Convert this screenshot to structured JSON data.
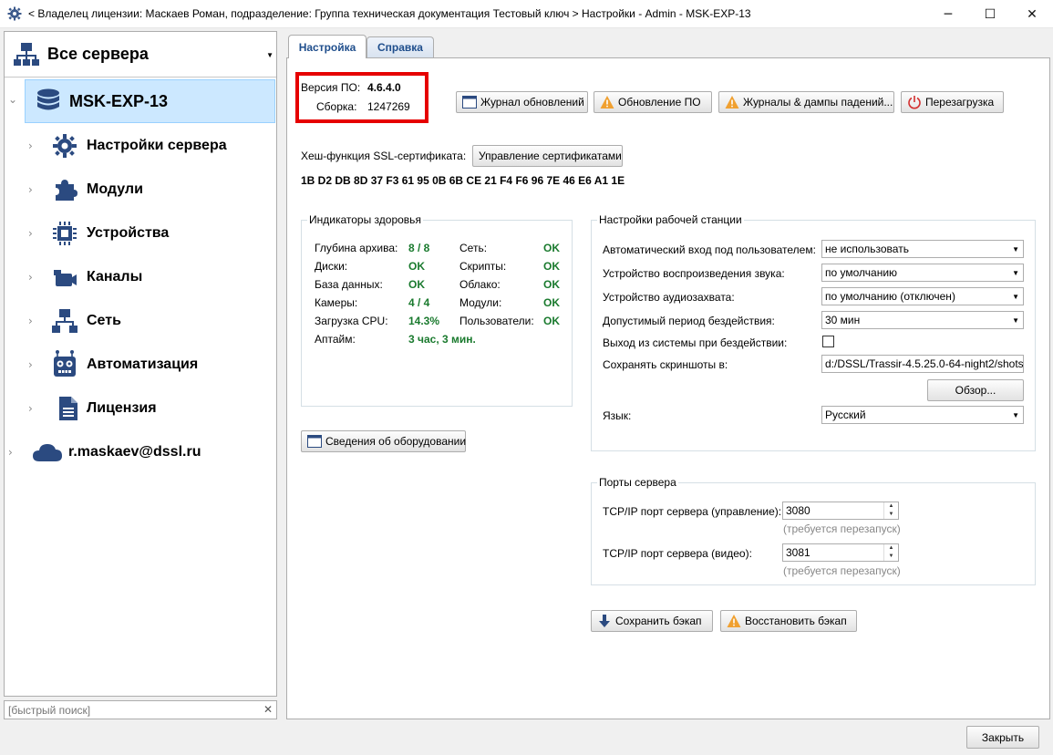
{
  "window": {
    "title": "< Владелец лицензии: Маскаев Роман, подразделение: Группа техническая документация Тестовый ключ > Настройки - Admin - MSK-EXP-13",
    "minimize": "─",
    "maximize": "☐",
    "close": "✕"
  },
  "sidebar": {
    "server_selector": "Все сервера",
    "server_name": "MSK-EXP-13",
    "items": [
      {
        "label": "Настройки сервера",
        "icon": "gear-icon"
      },
      {
        "label": "Модули",
        "icon": "puzzle-icon"
      },
      {
        "label": "Устройства",
        "icon": "chip-icon"
      },
      {
        "label": "Каналы",
        "icon": "camera-icon"
      },
      {
        "label": "Сеть",
        "icon": "network-icon"
      },
      {
        "label": "Автоматизация",
        "icon": "robot-icon"
      },
      {
        "label": "Лицензия",
        "icon": "document-icon"
      }
    ],
    "cloud_user": "r.maskaev@dssl.ru",
    "search_placeholder": "[быстрый поиск]",
    "search_clear": "✕"
  },
  "tabs": [
    {
      "label": "Настройка",
      "active": true
    },
    {
      "label": "Справка",
      "active": false
    }
  ],
  "version": {
    "version_label": "Версия ПО:",
    "version_value": "4.6.4.0",
    "build_label": "Сборка:",
    "build_value": "1247269"
  },
  "toolbar": {
    "update_log": "Журнал обновлений",
    "software_update": "Обновление ПО",
    "crash_logs": "Журналы & дампы падений...",
    "restart": "Перезагрузка"
  },
  "ssl": {
    "label": "Хеш-функция SSL-сертификата:",
    "manage_button": "Управление сертификатами",
    "hash": "1B D2 DB 8D 37 F3 61 95 0B 6B CE 21 F4 F6 96 7E 46 E6 A1 1E"
  },
  "health": {
    "title": "Индикаторы здоровья",
    "left": [
      {
        "label": "Глубина архива:",
        "value": "8 / 8"
      },
      {
        "label": "Диски:",
        "value": "OK"
      },
      {
        "label": "База данных:",
        "value": "OK"
      },
      {
        "label": "Камеры:",
        "value": "4 / 4"
      },
      {
        "label": "Загрузка CPU:",
        "value": "14.3%"
      },
      {
        "label": "Аптайм:",
        "value": "3 час, 3 мин."
      }
    ],
    "right": [
      {
        "label": "Сеть:",
        "value": "OK"
      },
      {
        "label": "Скрипты:",
        "value": "OK"
      },
      {
        "label": "Облако:",
        "value": "OK"
      },
      {
        "label": "Модули:",
        "value": "OK"
      },
      {
        "label": "Пользователи:",
        "value": "OK"
      }
    ]
  },
  "hardware_button": "Сведения об оборудовании",
  "workstation": {
    "title": "Настройки рабочей станции",
    "auto_login_label": "Автоматический вход под пользователем:",
    "auto_login_value": "не использовать",
    "sound_playback_label": "Устройство воспроизведения звука:",
    "sound_playback_value": "по умолчанию",
    "audio_capture_label": "Устройство аудиозахвата:",
    "audio_capture_value": "по умолчанию (отключен)",
    "idle_period_label": "Допустимый период бездействия:",
    "idle_period_value": "30 мин",
    "logout_idle_label": "Выход из системы при бездействии:",
    "logout_idle_checked": false,
    "screenshots_label": "Сохранять скриншоты в:",
    "screenshots_value": "d:/DSSL/Trassir-4.5.25.0-64-night2/shots",
    "browse_button": "Обзор...",
    "language_label": "Язык:",
    "language_value": "Русский"
  },
  "ports": {
    "title": "Порты сервера",
    "control_label": "TCP/IP порт сервера (управление):",
    "control_value": "3080",
    "control_hint": "(требуется перезапуск)",
    "video_label": "TCP/IP порт сервера (видео):",
    "video_value": "3081",
    "video_hint": "(требуется перезапуск)"
  },
  "backup": {
    "save": "Сохранить бэкап",
    "restore": "Восстановить бэкап"
  },
  "close_button": "Закрыть",
  "colors": {
    "accent": "#1f4e8c",
    "icon_blue": "#2b4a80",
    "ok_green": "#1a7a2e",
    "highlight_red": "#e60000",
    "warning_orange": "#f0a030",
    "selection": "#cce8ff"
  }
}
